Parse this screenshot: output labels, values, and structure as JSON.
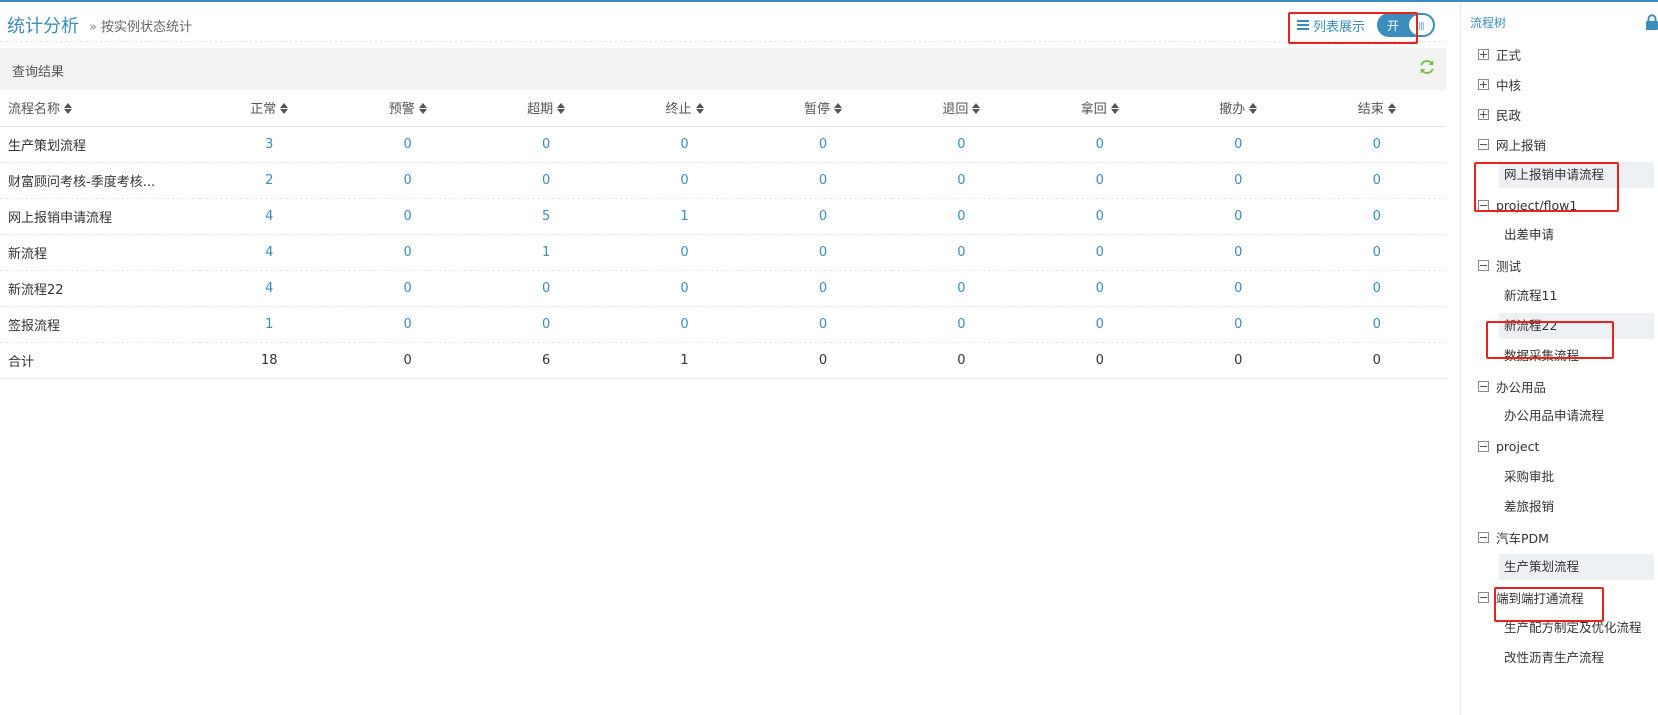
{
  "header": {
    "title": "统计分析",
    "breadcrumb_sep": "»",
    "breadcrumb": "按实例状态统计",
    "list_label": "列表展示",
    "switch_text": "开",
    "switch_knob": "|||"
  },
  "panel": {
    "title": "查询结果"
  },
  "table": {
    "columns": [
      "流程名称",
      "正常",
      "预警",
      "超期",
      "终止",
      "暂停",
      "退回",
      "拿回",
      "撤办",
      "结束"
    ],
    "rows": [
      {
        "name": "生产策划流程",
        "values": [
          "3",
          "0",
          "0",
          "0",
          "0",
          "0",
          "0",
          "0",
          "0"
        ]
      },
      {
        "name": "财富顾问考核-季度考核...",
        "values": [
          "2",
          "0",
          "0",
          "0",
          "0",
          "0",
          "0",
          "0",
          "0"
        ]
      },
      {
        "name": "网上报销申请流程",
        "values": [
          "4",
          "0",
          "5",
          "1",
          "0",
          "0",
          "0",
          "0",
          "0"
        ]
      },
      {
        "name": "新流程",
        "values": [
          "4",
          "0",
          "1",
          "0",
          "0",
          "0",
          "0",
          "0",
          "0"
        ]
      },
      {
        "name": "新流程22",
        "values": [
          "4",
          "0",
          "0",
          "0",
          "0",
          "0",
          "0",
          "0",
          "0"
        ]
      },
      {
        "name": "签报流程",
        "values": [
          "1",
          "0",
          "0",
          "0",
          "0",
          "0",
          "0",
          "0",
          "0"
        ]
      }
    ],
    "total": {
      "name": "合计",
      "values": [
        "18",
        "0",
        "6",
        "1",
        "0",
        "0",
        "0",
        "0",
        "0"
      ]
    }
  },
  "tree": {
    "title": "流程树",
    "groups": [
      {
        "label": "正式",
        "expanded": false
      },
      {
        "label": "中核",
        "expanded": false
      },
      {
        "label": "民政",
        "expanded": false
      },
      {
        "label": "网上报销",
        "expanded": true,
        "children": [
          "网上报销申请流程"
        ]
      },
      {
        "label": "project/flow1",
        "expanded": true,
        "children": [
          "出差申请"
        ]
      },
      {
        "label": "测试",
        "expanded": true,
        "children": [
          "新流程11",
          "新流程22",
          "数据采集流程"
        ]
      },
      {
        "label": "办公用品",
        "expanded": true,
        "children": [
          "办公用品申请流程"
        ]
      },
      {
        "label": "project",
        "expanded": true,
        "children": [
          "采购审批",
          "差旅报销"
        ]
      },
      {
        "label": "汽车PDM",
        "expanded": true,
        "children": [
          "生产策划流程"
        ]
      },
      {
        "label": "端到端打通流程",
        "expanded": true,
        "children": [
          "生产配方制定及优化流程",
          "改性沥青生产流程"
        ]
      }
    ]
  },
  "colors": {
    "accent": "#3c8dbc",
    "highlight": "#e8231d",
    "refresh": "#7cc04b"
  },
  "icons": [
    "list-icon",
    "refresh-icon",
    "lock-icon",
    "sort-icon",
    "plus-box-icon",
    "minus-box-icon"
  ]
}
